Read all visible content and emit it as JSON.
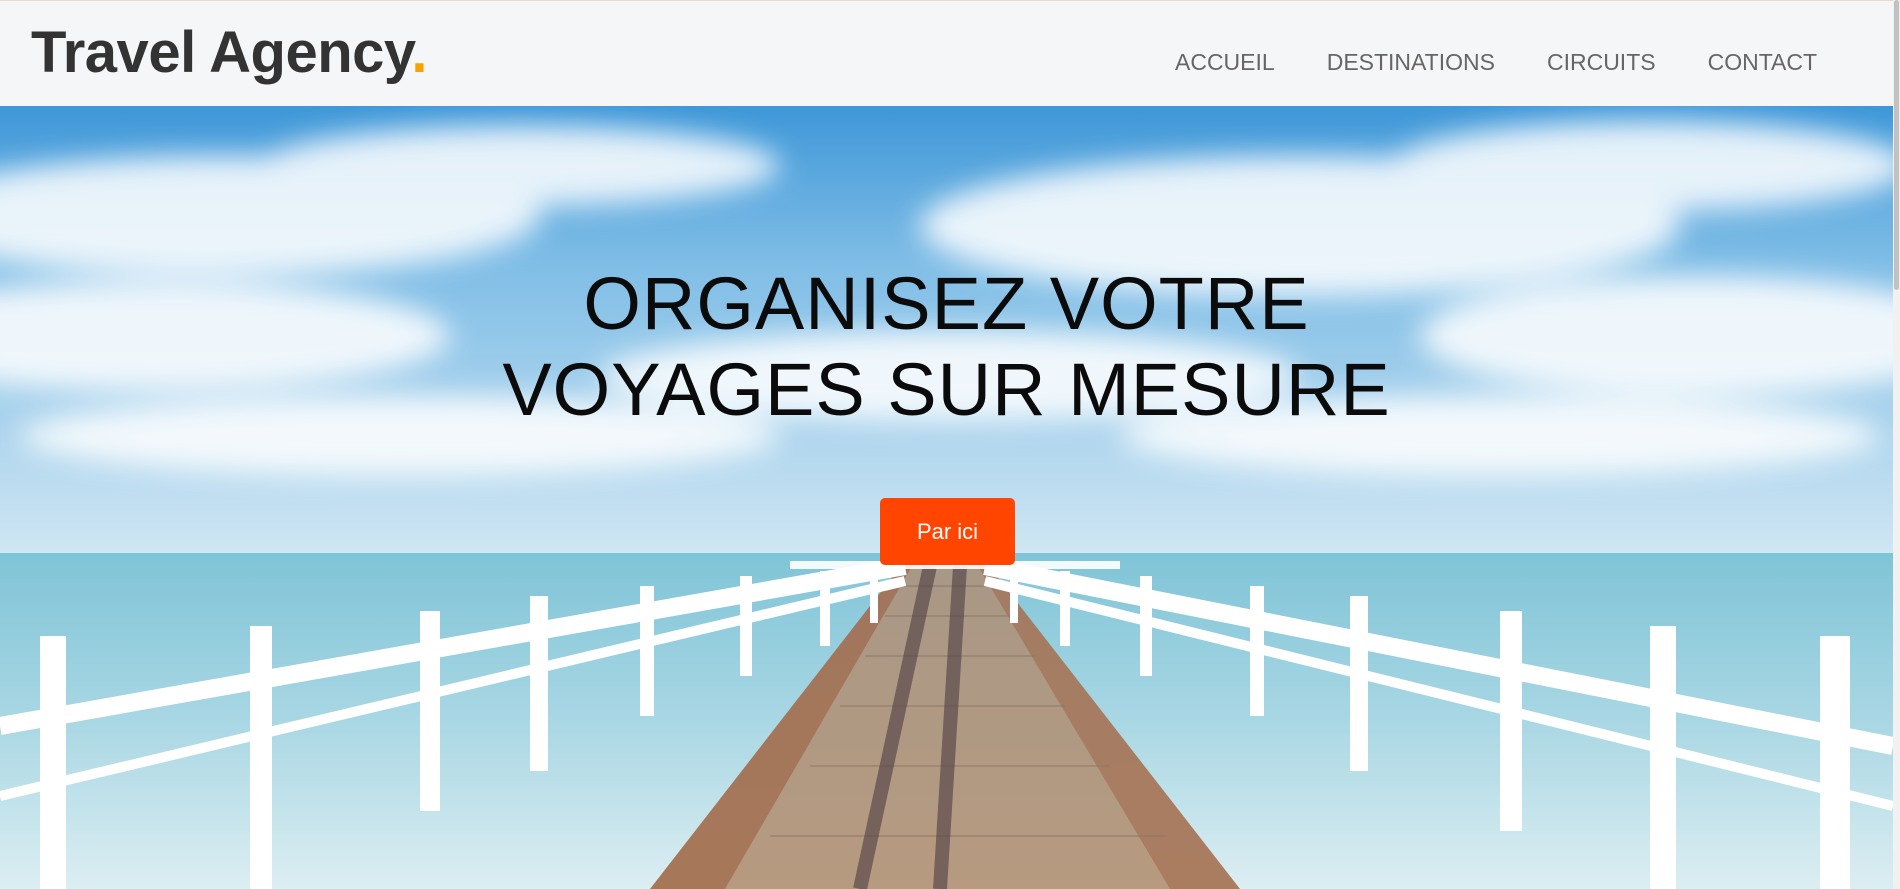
{
  "brand": {
    "name": "Travel Agency",
    "dot": ".",
    "dot_color": "#f5a300"
  },
  "nav": {
    "items": [
      {
        "label": "ACCUEIL"
      },
      {
        "label": "DESTINATIONS"
      },
      {
        "label": "CIRCUITS"
      },
      {
        "label": "CONTACT"
      }
    ]
  },
  "hero": {
    "headline_line1": "ORGANISEZ VOTRE",
    "headline_line2": "VOYAGES SUR MESURE",
    "cta_label": "Par ici",
    "cta_color": "#ff4500",
    "image": "pier-over-ocean"
  }
}
